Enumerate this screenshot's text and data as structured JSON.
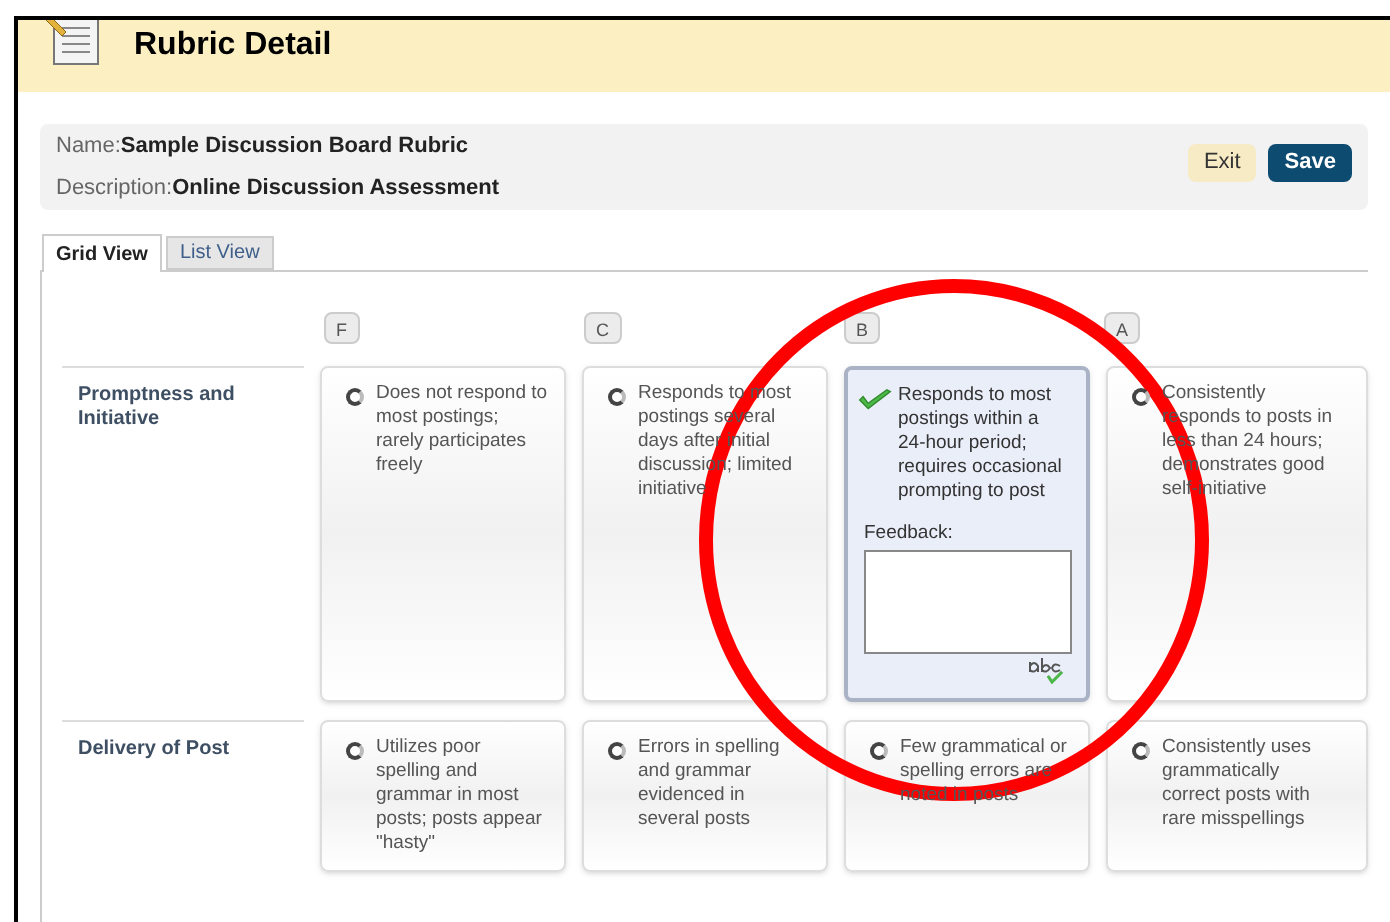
{
  "header": {
    "title": "Rubric Detail"
  },
  "info": {
    "name_label": "Name:",
    "name": "Sample Discussion Board Rubric",
    "description_label": "Description:",
    "description": "Online Discussion Assessment"
  },
  "buttons": [
    {
      "label": "Exit",
      "kind": "secondary"
    },
    {
      "label": "Save",
      "kind": "primary"
    }
  ],
  "tabs": [
    {
      "label": "Grid View",
      "selected": true
    },
    {
      "label": "List View",
      "selected": false
    }
  ],
  "columns": [
    "F",
    "C",
    "B",
    "A"
  ],
  "rows": [
    {
      "criterion": "Promptness and Initiative",
      "cells": [
        {
          "text": "Does not respond to most postings; rarely participates freely",
          "selected": false
        },
        {
          "text": "Responds to most postings several days after initial discussion; limited initiative",
          "selected": false
        },
        {
          "text": "Responds to most postings within a 24-hour period; requires occasional prompting to post",
          "selected": true,
          "feedback_label": "Feedback:"
        },
        {
          "text": "Consistently responds to posts in less than 24 hours; demonstrates good self-initiative",
          "selected": false
        }
      ]
    },
    {
      "criterion": "Delivery of Post",
      "cells": [
        {
          "text": "Utilizes poor spelling and grammar in most posts; posts appear \"hasty\"",
          "selected": false
        },
        {
          "text": "Errors in spelling and grammar evidenced in several posts",
          "selected": false
        },
        {
          "text": "Few grammatical or spelling errors are noted in posts",
          "selected": false
        },
        {
          "text": "Consistently uses grammatically correct posts with rare misspellings",
          "selected": false
        }
      ]
    }
  ]
}
